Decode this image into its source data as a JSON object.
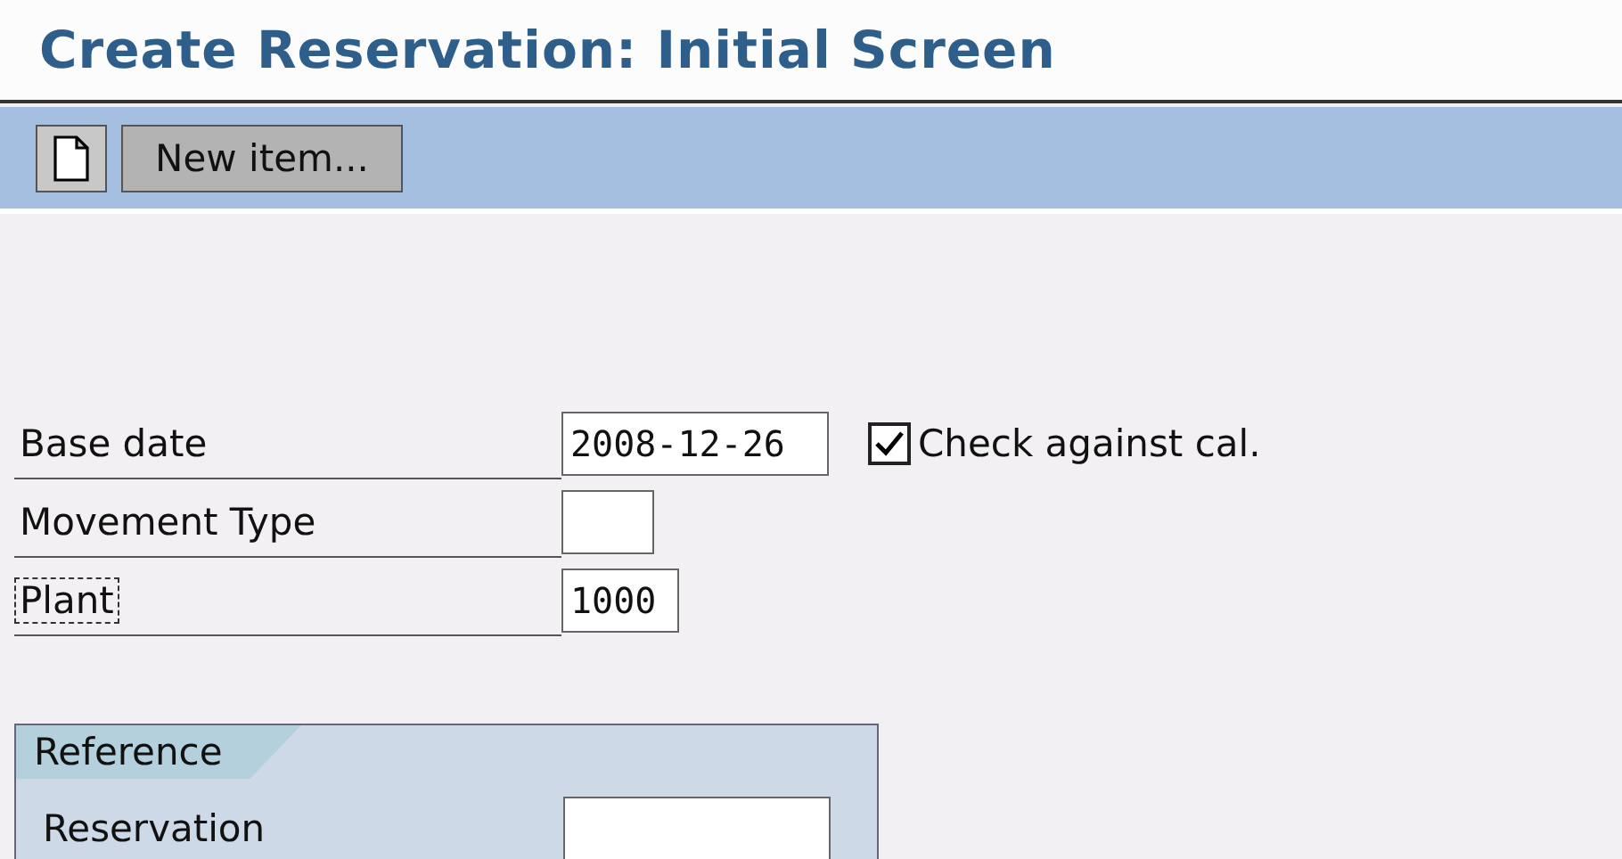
{
  "title": "Create Reservation: Initial Screen",
  "toolbar": {
    "new_item_label": "New item..."
  },
  "fields": [
    {
      "label": "Base date",
      "value": "2008-12-26",
      "focused": false,
      "checkbox": {
        "label": "Check against cal.",
        "checked": true
      }
    },
    {
      "label": "Movement Type",
      "focused": false
    },
    {
      "label": "Plant",
      "value": "1000",
      "focused": true
    }
  ],
  "group": {
    "title": "Reference",
    "fields": [
      {
        "label": "Reservation"
      }
    ]
  }
}
